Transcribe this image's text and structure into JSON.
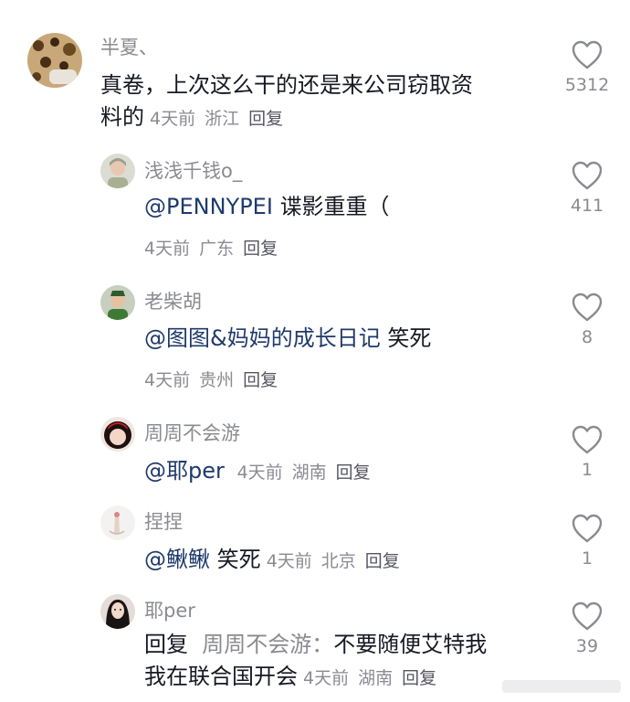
{
  "comments": [
    {
      "name": "半夏、",
      "text_line1": "真卷，上次这么干的还是来公司窃取资",
      "text_line2": "料的",
      "time": "4天前",
      "location": "浙江",
      "reply": "回复",
      "likes": "5312"
    },
    {
      "name": "浅浅千钱o_",
      "mention": "@PENNYPEI",
      "text": "谍影重重（",
      "time": "4天前",
      "location": "广东",
      "reply": "回复",
      "likes": "411"
    },
    {
      "name": "老柴胡",
      "mention": "@图图&妈妈的成长日记",
      "text": "笑死",
      "time": "4天前",
      "location": "贵州",
      "reply": "回复",
      "likes": "8"
    },
    {
      "name": "周周不会游",
      "mention": "@耶per",
      "time": "4天前",
      "location": "湖南",
      "reply": "回复",
      "likes": "1"
    },
    {
      "name": "捏捏",
      "mention": "@鳅鳅",
      "text": "笑死",
      "time": "4天前",
      "location": "北京",
      "reply": "回复",
      "likes": "1"
    },
    {
      "name": "耶per",
      "reply_prefix": "回复",
      "reply_target": "周周不会游：",
      "text_line1": "不要随便艾特我",
      "text_line2": "我在联合国开会",
      "time": "4天前",
      "location": "湖南",
      "reply": "回复",
      "likes": "39"
    }
  ],
  "icons": {
    "like": "heart-outline-icon"
  },
  "colors": {
    "text": "#161823",
    "secondary": "#8a8b91",
    "mention": "#1f3a6b"
  }
}
